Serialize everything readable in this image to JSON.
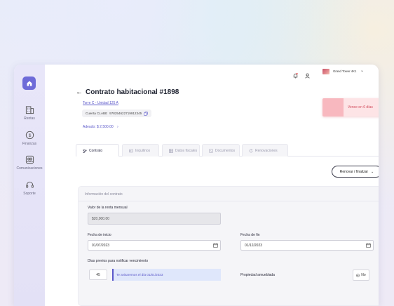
{
  "sidebar": {
    "items": [
      {
        "label": "Rentas",
        "icon": "building-icon"
      },
      {
        "label": "Finanzas",
        "icon": "dollar-icon"
      },
      {
        "label": "Comunicaciones",
        "icon": "contacts-icon"
      },
      {
        "label": "Soporte",
        "icon": "headset-icon"
      }
    ]
  },
  "topbar": {
    "user_name": "Grand Tower 4K1"
  },
  "contract": {
    "title": "Contrato habitacional #1898",
    "unit": "Torre C - Unidad 125 A",
    "clabe_label": "Cuenta CLABE",
    "clabe_value": "978254622719912345",
    "adeudo": "Adeudo: $ 2,500.00",
    "due_badge": "Vence en 6 días"
  },
  "tabs": [
    {
      "label": "Contrato",
      "icon": "contract-icon",
      "active": true
    },
    {
      "label": "Inquilinos",
      "icon": "users-icon",
      "active": false
    },
    {
      "label": "Datos fiscales",
      "icon": "table-icon",
      "active": false
    },
    {
      "label": "Documentos",
      "icon": "document-icon",
      "active": false
    },
    {
      "label": "Renovaciones",
      "icon": "refresh-icon",
      "active": false
    }
  ],
  "actions": {
    "renovar_label": "Renovar / finalizar"
  },
  "form": {
    "section_title": "Información del contrato",
    "renta_label": "Valor de la renta mensual",
    "renta_value": "$20,000.00",
    "inicio_label": "Fecha de inicio",
    "inicio_value": "01/07/2023",
    "fin_label": "Fecha de fin",
    "fin_value": "01/12/2023",
    "dias_label": "Días previos para notificar vencimiento",
    "dias_value": "45",
    "dias_info": "Te avisaremos el día 01/01/2023",
    "amueblada_label": "Propiedad amueblada",
    "amueblada_value": "No"
  },
  "colors": {
    "accent": "#5a57c9",
    "logo": "#6e6bd8",
    "due": "#d24b5b"
  }
}
